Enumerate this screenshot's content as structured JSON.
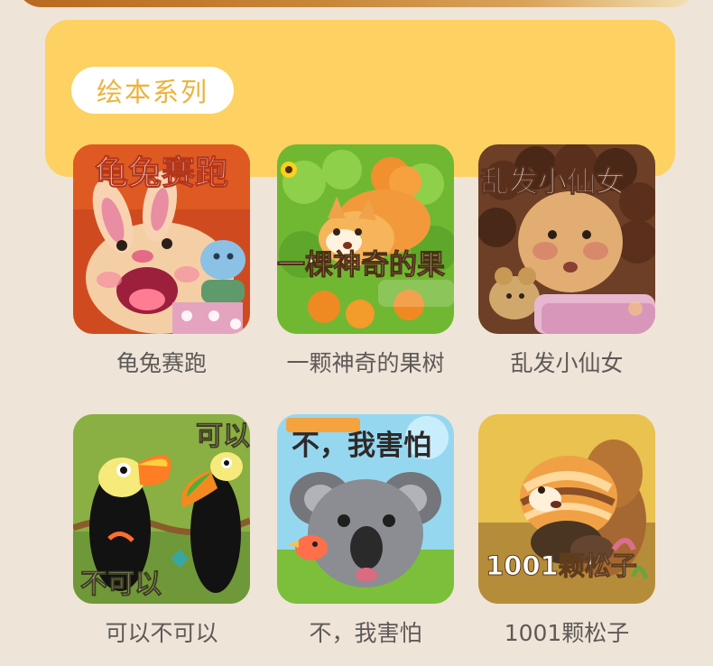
{
  "section": {
    "title": "绘本系列"
  },
  "books": [
    {
      "title": "龟兔赛跑",
      "cover_text": "龟兔赛跑",
      "cover_icon": "rabbit-and-turtle-illustration"
    },
    {
      "title": "一颗神奇的果树",
      "cover_text": "一棵神奇的果",
      "cover_icon": "squirrel-illustration"
    },
    {
      "title": "乱发小仙女",
      "cover_text": "乱发小仙女",
      "cover_icon": "curly-hair-girl-illustration"
    },
    {
      "title": "可以不可以",
      "cover_text_top": "可以",
      "cover_text_bottom": "不可以",
      "cover_icon": "toucan-illustration"
    },
    {
      "title": "不，我害怕",
      "cover_text": "不，我害怕",
      "cover_icon": "koala-illustration"
    },
    {
      "title": "1001颗松子",
      "cover_text": "1001颗松子",
      "cover_icon": "chipmunk-illustration"
    }
  ],
  "colors": {
    "page_background": "#efe4d8",
    "panel_yellow": "#fdd162",
    "pill_text": "#ecb33d",
    "title_text": "#5d5a57"
  }
}
